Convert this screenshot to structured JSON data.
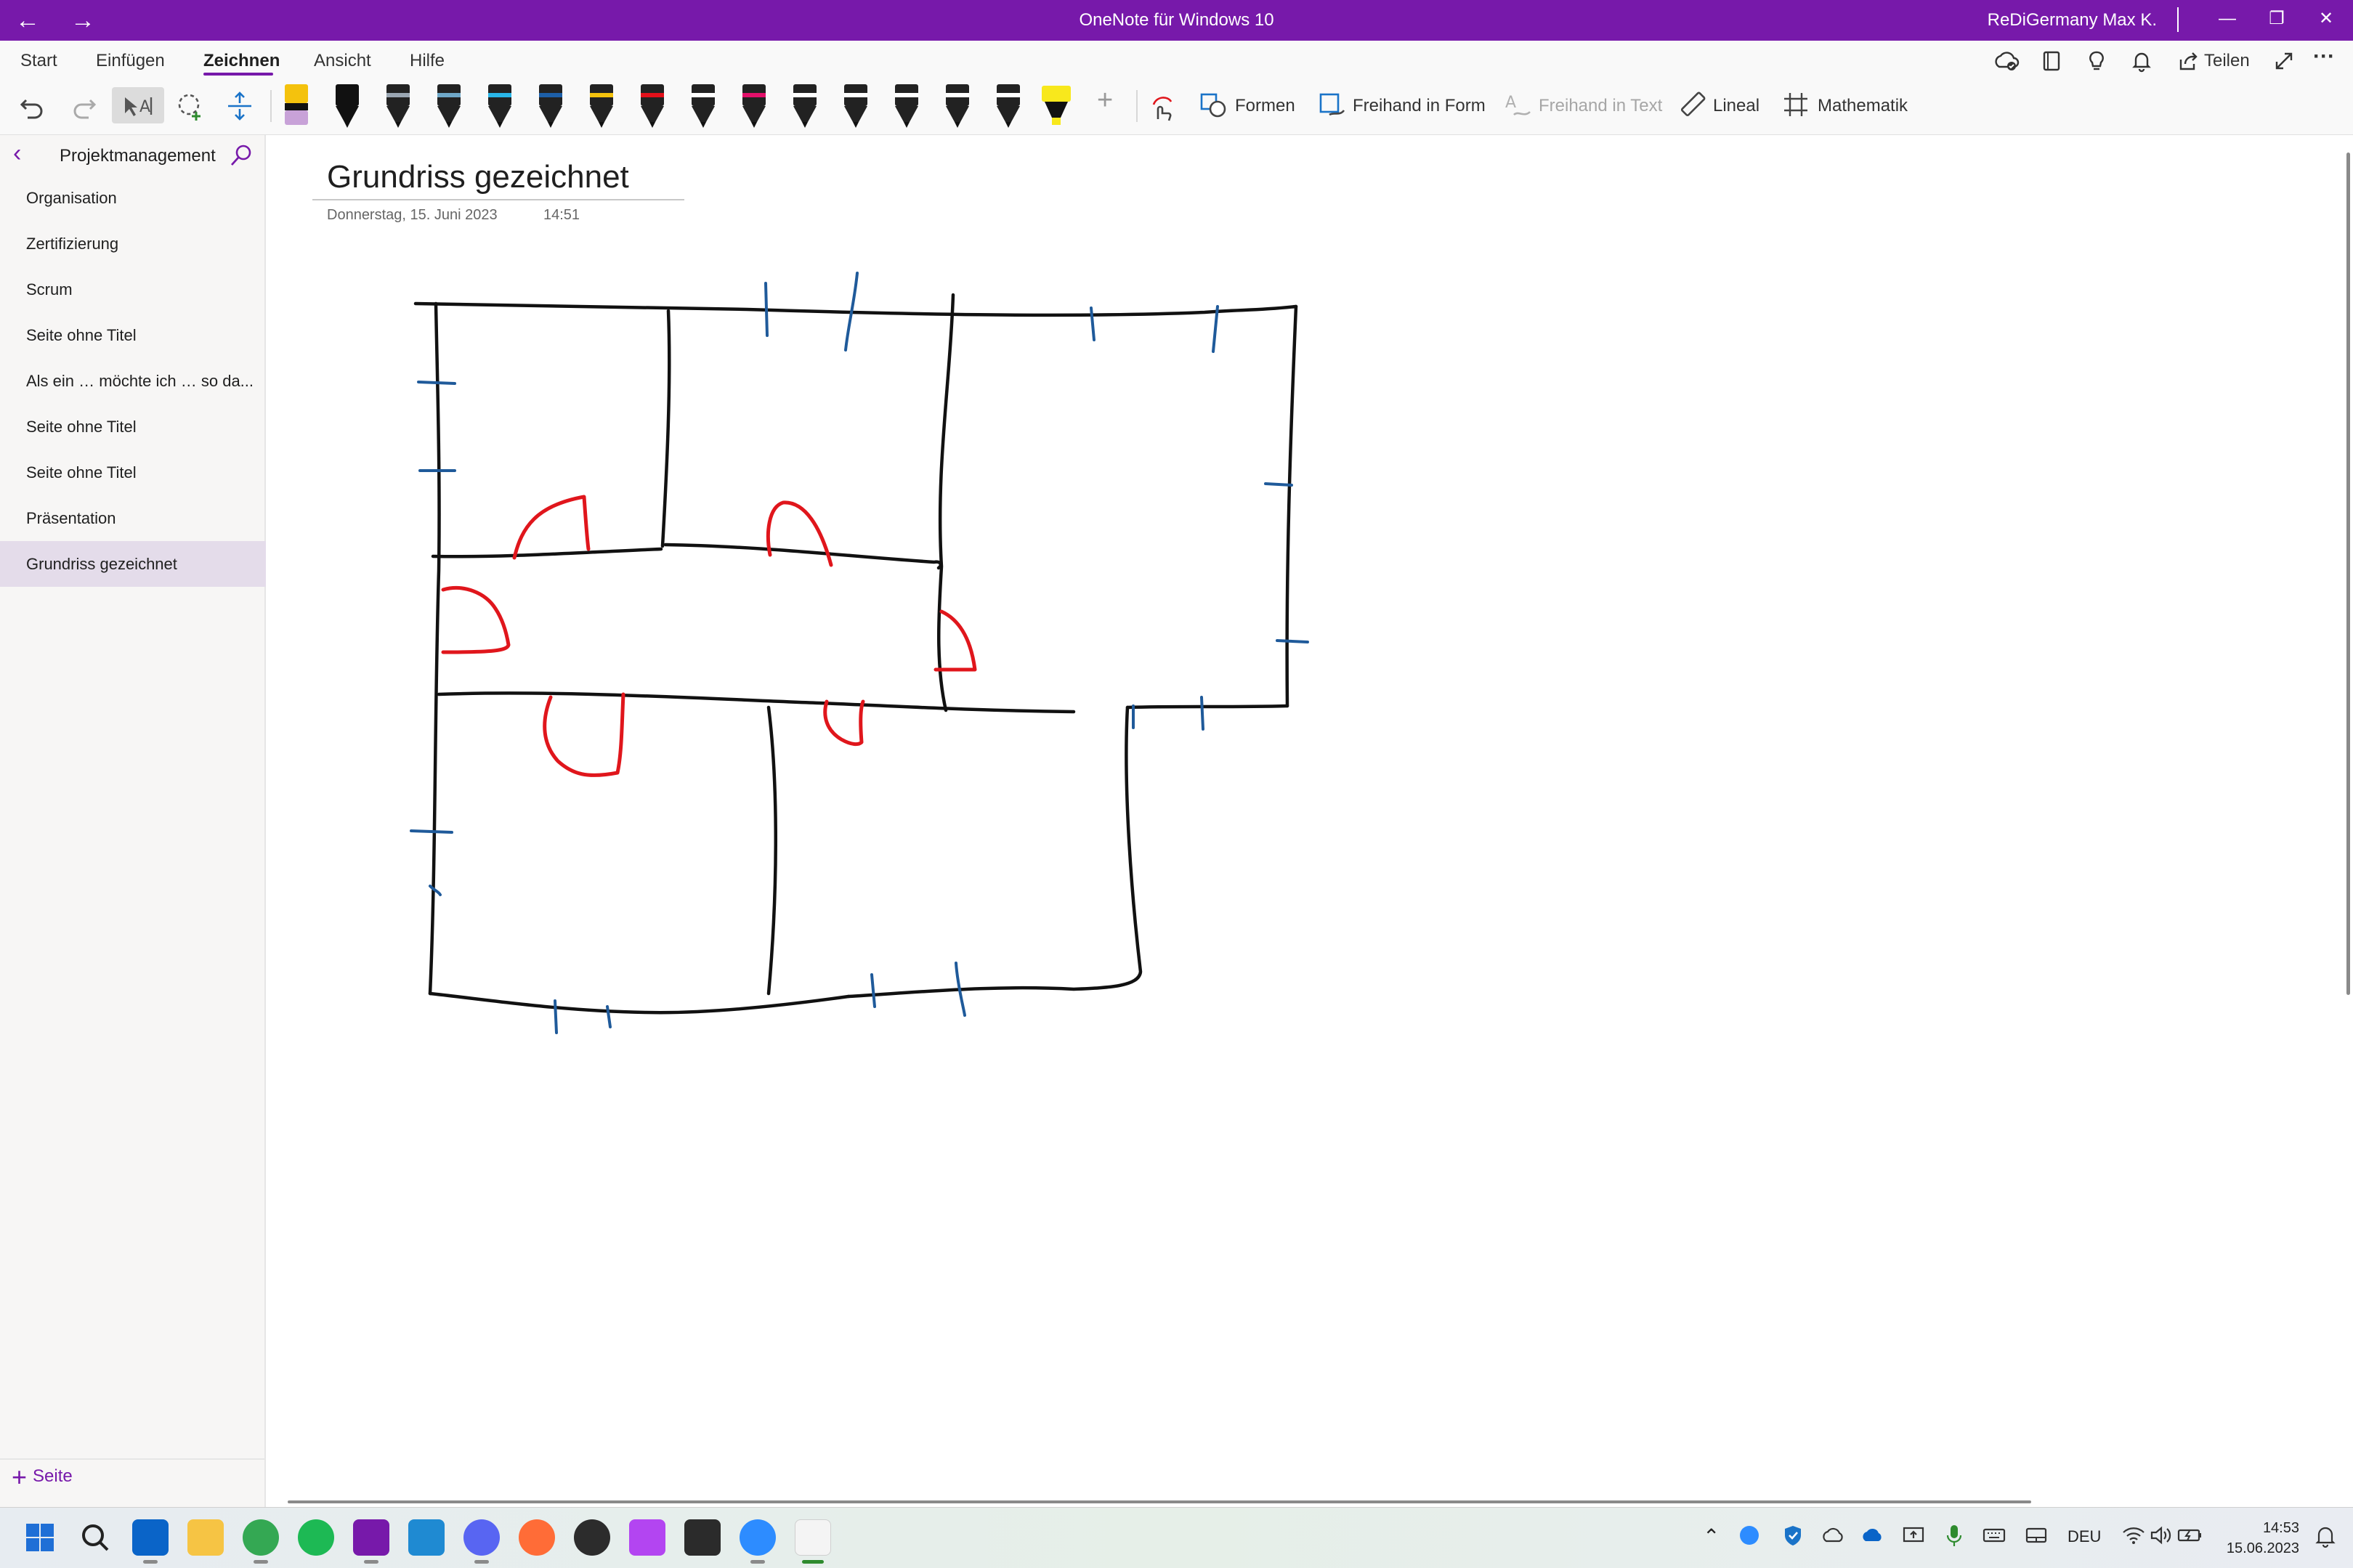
{
  "window": {
    "title": "OneNote für Windows 10",
    "user": "ReDiGermany Max K.",
    "back_glyph": "←",
    "forward_glyph": "→",
    "minimize_glyph": "—",
    "restore_glyph": "❐",
    "close_glyph": "✕"
  },
  "ribbon": {
    "tabs": [
      "Start",
      "Einfügen",
      "Zeichnen",
      "Ansicht",
      "Hilfe"
    ],
    "active_tab": "Zeichnen",
    "share_label": "Teilen",
    "more_glyph": "···"
  },
  "toolbar": {
    "pens": [
      {
        "tip": "#222222",
        "body": "#222222",
        "band": "#c8a2d8"
      },
      {
        "tip": "#111111",
        "body": "#111111",
        "band": "#111111"
      },
      {
        "tip": "#111111",
        "body": "#222222",
        "band": "#9aa6b2"
      },
      {
        "tip": "#111111",
        "body": "#222222",
        "band": "#6fa8c8"
      },
      {
        "tip": "#111111",
        "body": "#222222",
        "band": "#29b6e8"
      },
      {
        "tip": "#111111",
        "body": "#222222",
        "band": "#1d5fa8"
      },
      {
        "tip": "#111111",
        "body": "#222222",
        "band": "#f4c20d"
      },
      {
        "tip": "#111111",
        "body": "#222222",
        "band": "#e3101a"
      },
      {
        "tip": "#111111",
        "body": "#222222",
        "band": "#ffffff"
      },
      {
        "tip": "#111111",
        "body": "#222222",
        "band": "#e3106a"
      },
      {
        "tip": "#111111",
        "body": "#222222",
        "band": "#ffffff"
      },
      {
        "tip": "#111111",
        "body": "#222222",
        "band": "#ffffff"
      },
      {
        "tip": "#111111",
        "body": "#222222",
        "band": "#ffffff"
      },
      {
        "tip": "#111111",
        "body": "#222222",
        "band": "#ffffff"
      },
      {
        "tip": "#111111",
        "body": "#222222",
        "band": "#ffffff"
      }
    ],
    "highlighter_color": "#f8e81c",
    "tools": {
      "formen": "Formen",
      "freihand_in_form": "Freihand in Form",
      "freihand_in_text": "Freihand in Text",
      "lineal": "Lineal",
      "mathematik": "Mathematik"
    }
  },
  "sidebar": {
    "section_title": "Projektmanagement",
    "pages": [
      "Organisation",
      "Zertifizierung",
      "Scrum",
      "Seite ohne Titel",
      "Als ein … möchte ich … so da...",
      "Seite ohne Titel",
      "Seite ohne Titel",
      "Präsentation",
      "Grundriss gezeichnet"
    ],
    "active_page_index": 8,
    "add_page_label": "Seite"
  },
  "page": {
    "title": "Grundriss gezeichnet",
    "date": "Donnerstag, 15. Juni 2023",
    "time": "14:51"
  },
  "ink_colors": {
    "walls": "#111111",
    "windows": "#1f5a9a",
    "doors": "#e0161c"
  },
  "taskbar": {
    "apps": [
      {
        "name": "start",
        "color": "#1f6fd6"
      },
      {
        "name": "search",
        "color": "#222222"
      },
      {
        "name": "mail",
        "color": "#0a64c8"
      },
      {
        "name": "explorer",
        "color": "#f6c444"
      },
      {
        "name": "chrome",
        "color": "#34a853"
      },
      {
        "name": "spotify",
        "color": "#1db954"
      },
      {
        "name": "onenote",
        "color": "#7719aa"
      },
      {
        "name": "vscode",
        "color": "#1f8ad2"
      },
      {
        "name": "discord",
        "color": "#5865f2"
      },
      {
        "name": "postman",
        "color": "#ff6c37"
      },
      {
        "name": "hs-app",
        "color": "#2c2c2c"
      },
      {
        "name": "phpstorm",
        "color": "#b345f1"
      },
      {
        "name": "terminal",
        "color": "#2b2b2b"
      },
      {
        "name": "zoom",
        "color": "#2d8cff"
      },
      {
        "name": "blank-app",
        "color": "#f4f4f4"
      }
    ],
    "language": "DEU",
    "clock_time": "14:53",
    "clock_date": "15.06.2023",
    "tray_chevron": "⌃"
  }
}
